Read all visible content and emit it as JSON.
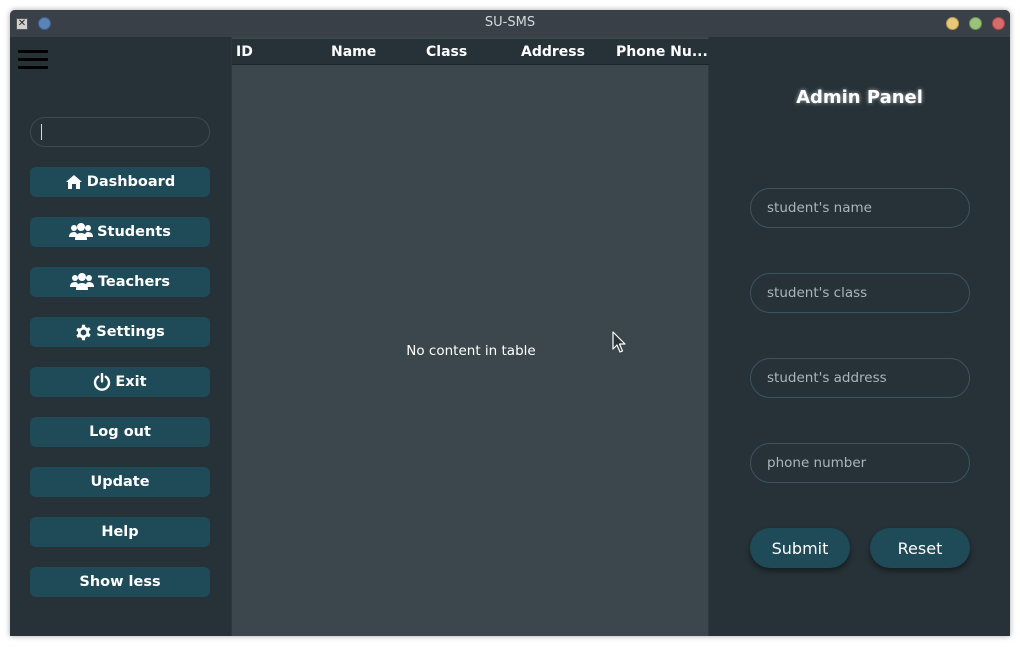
{
  "window": {
    "title": "SU-SMS"
  },
  "sidebar": {
    "search": {
      "value": "",
      "placeholder": ""
    },
    "items": [
      {
        "label": "Dashboard",
        "icon": "home-icon"
      },
      {
        "label": "Students",
        "icon": "users-icon"
      },
      {
        "label": "Teachers",
        "icon": "users-icon"
      },
      {
        "label": "Settings",
        "icon": "gear-icon"
      },
      {
        "label": "Exit",
        "icon": "power-icon"
      },
      {
        "label": "Log out",
        "icon": ""
      },
      {
        "label": "Update",
        "icon": ""
      },
      {
        "label": "Help",
        "icon": ""
      },
      {
        "label": "Show less",
        "icon": ""
      }
    ]
  },
  "table": {
    "columns": [
      "ID",
      "Name",
      "Class",
      "Address",
      "Phone Nu..."
    ],
    "rows": [],
    "empty_message": "No content in table"
  },
  "panel": {
    "title": "Admin Panel",
    "fields": {
      "name": {
        "value": "",
        "placeholder": "student's name"
      },
      "class": {
        "value": "",
        "placeholder": "student's class"
      },
      "address": {
        "value": "",
        "placeholder": "student's address"
      },
      "phone": {
        "value": "",
        "placeholder": "phone number"
      }
    },
    "submit_label": "Submit",
    "reset_label": "Reset"
  },
  "colors": {
    "background": "#263238",
    "table_body": "#3c474d",
    "button": "#1f4a57",
    "text": "#ffffff"
  }
}
